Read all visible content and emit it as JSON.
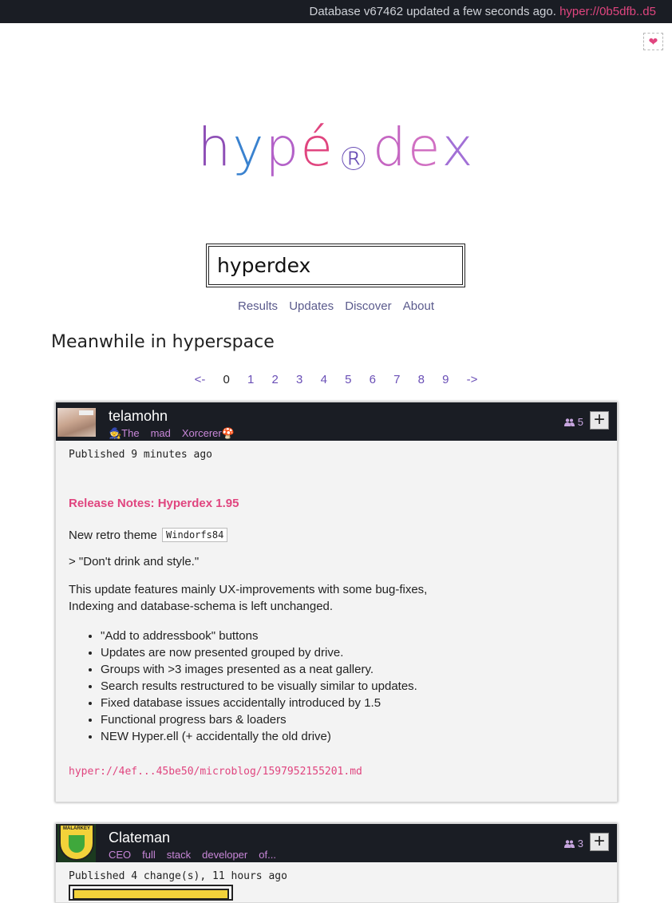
{
  "topbar": {
    "status_text": "Database v67462 updated a few seconds ago.",
    "status_link": "hyper://0b5dfb..d5"
  },
  "heart_icon": "heart-icon",
  "logo": {
    "chars": [
      "h",
      "y",
      "p",
      "é",
      "®",
      "d",
      "e",
      "x"
    ]
  },
  "search": {
    "value": "hyperdex"
  },
  "nav": {
    "items": [
      "Results",
      "Updates",
      "Discover",
      "About"
    ]
  },
  "heading": "Meanwhile in hyperspace",
  "pager": {
    "prev": "<-",
    "pages": [
      "0",
      "1",
      "2",
      "3",
      "4",
      "5",
      "6",
      "7",
      "8",
      "9"
    ],
    "current": "0",
    "next": "->"
  },
  "posts": [
    {
      "author": "telamohn",
      "tags": [
        "🧙The",
        "mad",
        "Xorcerer🍄"
      ],
      "followers": "5",
      "published": "Published 9 minutes ago",
      "title": "Release Notes: Hyperdex 1.95",
      "line1_text": "New retro theme",
      "line1_code": "Windorfs84",
      "quote": "> \"Don't drink and style.\"",
      "para": "This update features mainly UX-improvements with some bug-fixes, Indexing and database-schema is left unchanged.",
      "bullets": [
        "\"Add to addressbook\" buttons",
        "Updates are now presented grouped by drive.",
        "Groups with >3 images presented as a neat gallery.",
        "Search results restructured to be visually similar to updates.",
        "Fixed database issues accidentally introduced by 1.5",
        "Functional progress bars & loaders",
        "NEW Hyper.ell (+ accidentally the old drive)"
      ],
      "link": "hyper://4ef...45be50/microblog/1597952155201.md"
    },
    {
      "author": "Clateman",
      "tags": [
        "CEO",
        "full",
        "stack",
        "developer",
        "of..."
      ],
      "followers": "3",
      "published": "Published 4 change(s), 11 hours ago"
    }
  ],
  "colors": {
    "accent": "#e0457f",
    "dark": "#1a1d24",
    "link": "#6a4fb6"
  }
}
